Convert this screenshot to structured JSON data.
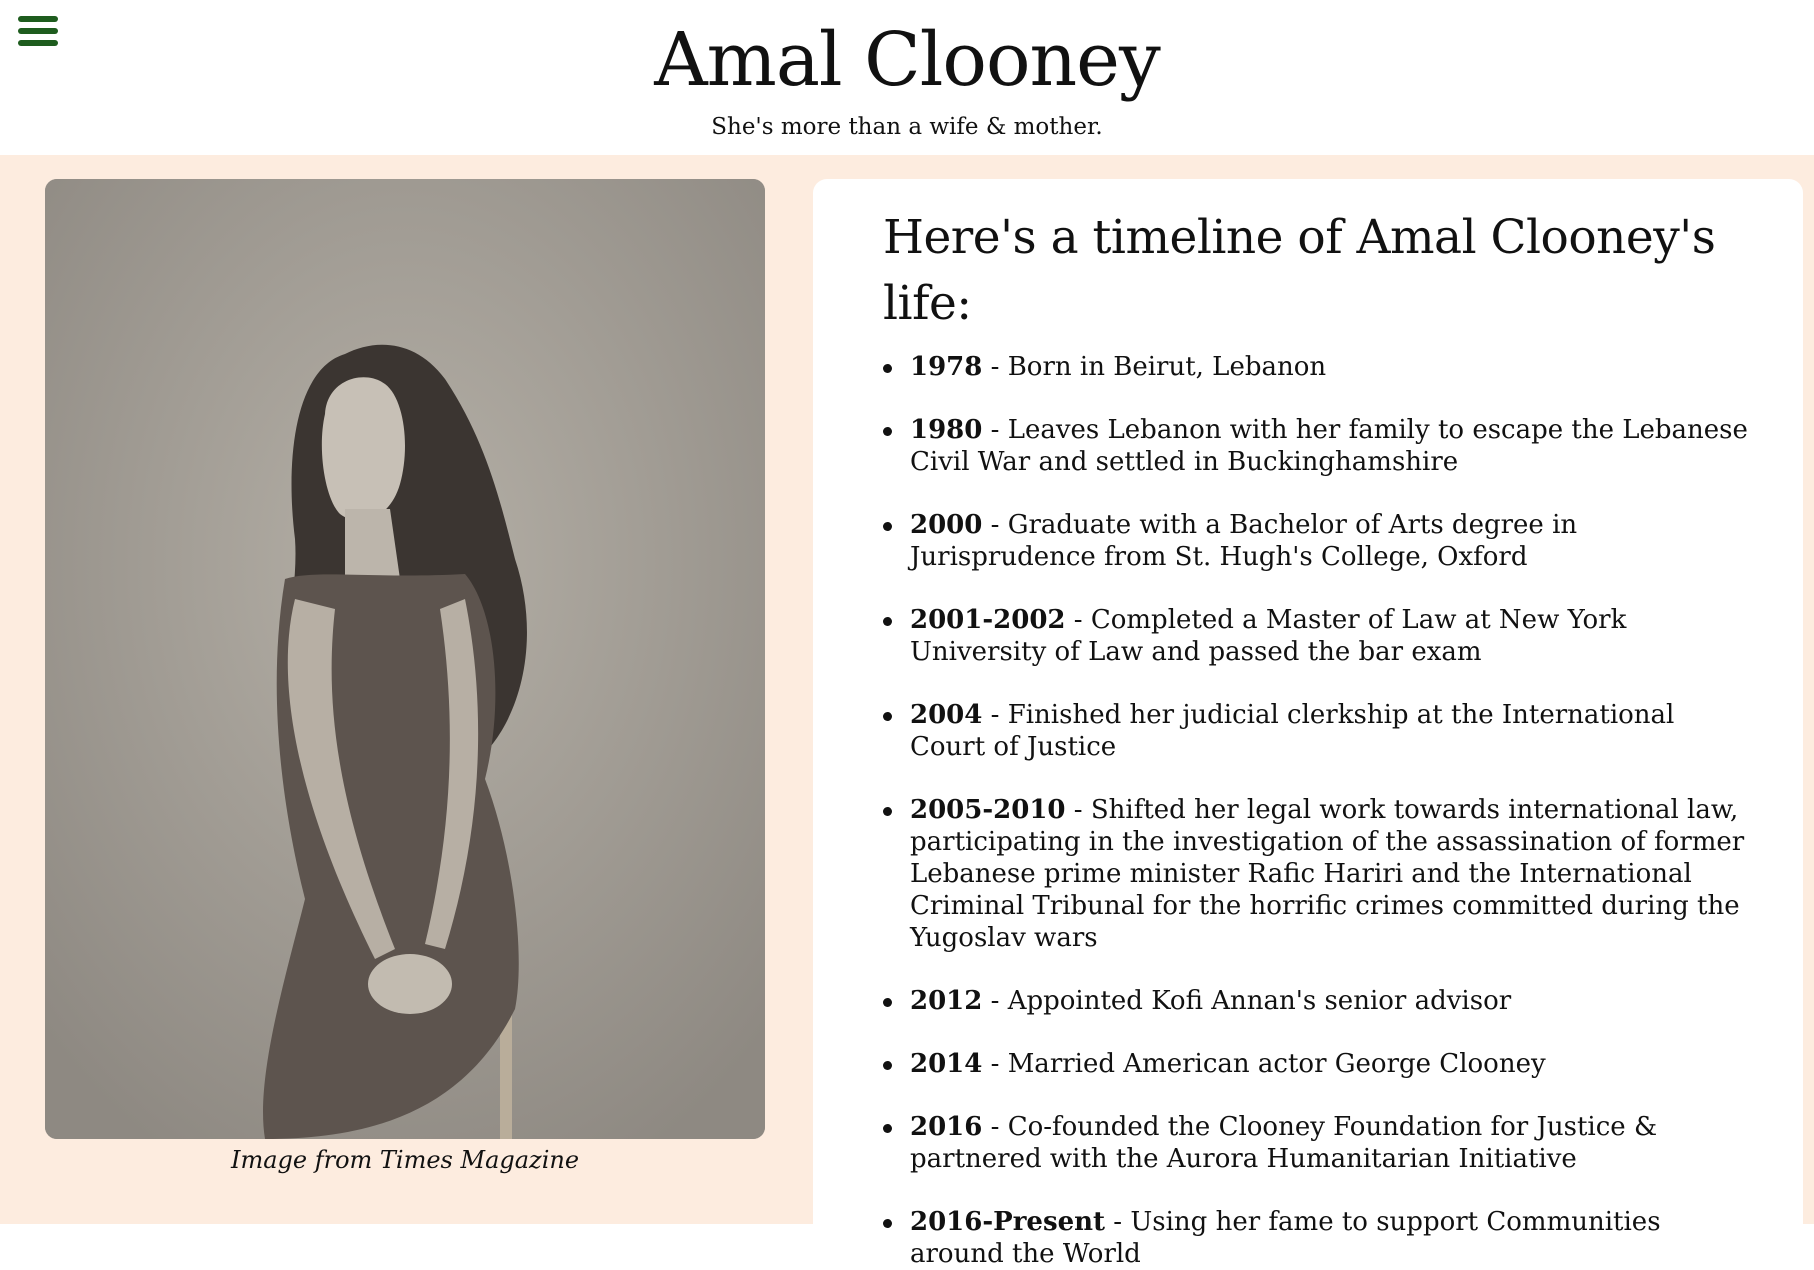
{
  "header": {
    "title": "Amal Clooney",
    "tagline": "She's more than a wife & mother.",
    "menu_icon": "hamburger-menu-icon",
    "menu_color": "#1e5c1e"
  },
  "photo": {
    "caption": "Image from Times Magazine",
    "description_icon": "portrait-photo"
  },
  "timeline": {
    "heading": "Here's a timeline of Amal Clooney's life:",
    "items": [
      {
        "year": "1978",
        "text": " - Born in Beirut, Lebanon"
      },
      {
        "year": "1980",
        "text": " - Leaves Lebanon with her family to escape the Lebanese Civil War and settled in Buckinghamshire"
      },
      {
        "year": "2000",
        "text": " - Graduate with a Bachelor of Arts degree in Jurisprudence from St. Hugh's College, Oxford"
      },
      {
        "year": "2001-2002",
        "text": " - Completed a Master of Law at New York University of Law and passed the bar exam"
      },
      {
        "year": "2004",
        "text": " - Finished her judicial clerkship at the International Court of Justice"
      },
      {
        "year": "2005-2010",
        "text": " - Shifted her legal work towards international law, participating in the investigation of the assassination of former Lebanese prime minister Rafic Hariri and the International Criminal Tribunal for the horrific crimes committed during the Yugoslav wars"
      },
      {
        "year": "2012",
        "text": " - Appointed Kofi Annan's senior advisor"
      },
      {
        "year": "2014",
        "text": " - Married American actor George Clooney"
      },
      {
        "year": "2016",
        "text": " - Co-founded the Clooney Foundation for Justice & partnered with the Aurora Humanitarian Initiative"
      },
      {
        "year": "2016-Present",
        "text": " - Using her fame to support Communities around the World"
      }
    ]
  },
  "colors": {
    "page_background": "#fdecdf",
    "card_background": "#ffffff",
    "text": "#111111"
  }
}
